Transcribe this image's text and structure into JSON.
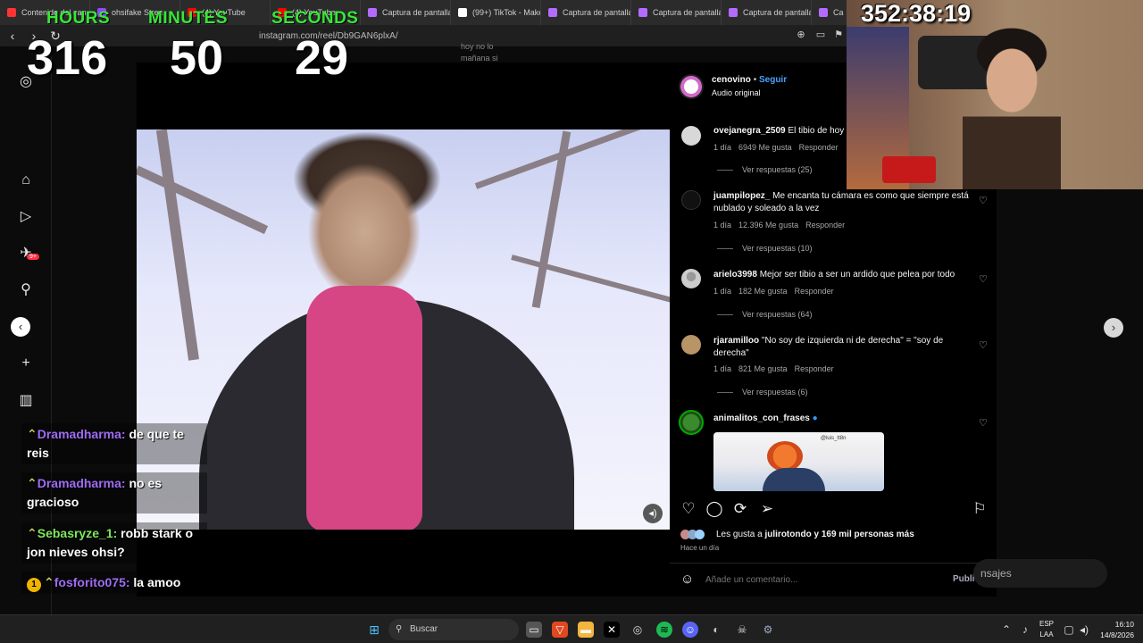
{
  "browser": {
    "tabs": [
      {
        "title": "Contenido del can",
        "color": "#ff3333"
      },
      {
        "title": "ohsifake Strea",
        "color": "#9146ff"
      },
      {
        "title": "(4) YouTube",
        "color": "#ff0000"
      },
      {
        "title": "(4) YouTube",
        "color": "#ff0000"
      },
      {
        "title": "Captura de pantalla",
        "color": "#b46bff"
      },
      {
        "title": "(99+) TikTok - Make",
        "color": "#ffffff"
      },
      {
        "title": "Captura de pantalla",
        "color": "#b46bff"
      },
      {
        "title": "Captura de pantalla",
        "color": "#b46bff"
      },
      {
        "title": "Captura de pantalla",
        "color": "#b46bff"
      },
      {
        "title": "Ca",
        "color": "#b46bff"
      }
    ],
    "url": "instagram.com/reel/Db9GAN6plxA/",
    "back_icon": "‹",
    "forward_icon": "›",
    "reload_icon": "↻"
  },
  "counter": {
    "hours_label": "HOURS",
    "minutes_label": "MINUTES",
    "seconds_label": "SECONDS",
    "hours": "316",
    "minutes": "50",
    "seconds": "29"
  },
  "webcam": {
    "timer": "352:38:19"
  },
  "leftnav": {
    "badge": "9+"
  },
  "background_preview": {
    "line1": "hoy no lo",
    "line2": "mañana si"
  },
  "post": {
    "author": "cenovino",
    "follow_label": "Seguir",
    "audio": "Audio original",
    "comments": [
      {
        "user": "ovejanegra_2509",
        "text": "El tibio de hoy",
        "time": "1 día",
        "likes": "6949 Me gusta",
        "reply": "Responder",
        "replies": "Ver respuestas (25)"
      },
      {
        "user": "juampilopez_",
        "text": "Me encanta tu cámara es como que siempre está nublado y soleado a la vez",
        "time": "1 día",
        "likes": "12.396 Me gusta",
        "reply": "Responder",
        "replies": "Ver respuestas (10)"
      },
      {
        "user": "arielo3998",
        "text": "Mejor ser tibio a ser un ardido que pelea por todo",
        "time": "1 día",
        "likes": "182 Me gusta",
        "reply": "Responder",
        "replies": "Ver respuestas (64)"
      },
      {
        "user": "rjaramilloo",
        "text": "\"No soy de izquierda ni de derecha\" = \"soy de derecha\"",
        "time": "1 día",
        "likes": "821 Me gusta",
        "reply": "Responder",
        "replies": "Ver respuestas (6)"
      },
      {
        "user": "animalitos_con_frases",
        "text": "",
        "image_caption": "@luis_tt8n"
      }
    ],
    "likes_prefix": "Les gusta a ",
    "likes_user": "julirotondo",
    "likes_suffix": " y 169 mil personas más",
    "posted_ago": "Hace un día",
    "add_comment_placeholder": "Añade un comentario...",
    "publish_label": "Publicar"
  },
  "messages_pill": {
    "label": "nsajes"
  },
  "chat": [
    {
      "user": "Dramadharma",
      "message": "de que te reis",
      "user_color": "#a06cf6"
    },
    {
      "user": "Dramadharma",
      "message": "no es gracioso",
      "user_color": "#a06cf6"
    },
    {
      "user": "Sebasryze_1",
      "message": "robb stark o jon nieves ohsi?",
      "user_color": "#7ee85c"
    },
    {
      "user": "fosforito075",
      "message": "la amoo",
      "user_color": "#a06cf6",
      "badge": "1"
    }
  ],
  "taskbar": {
    "search_label": "Buscar",
    "lang_top": "ESP",
    "lang_bottom": "LAA",
    "time": "16:10",
    "date": "14/8/2026"
  }
}
